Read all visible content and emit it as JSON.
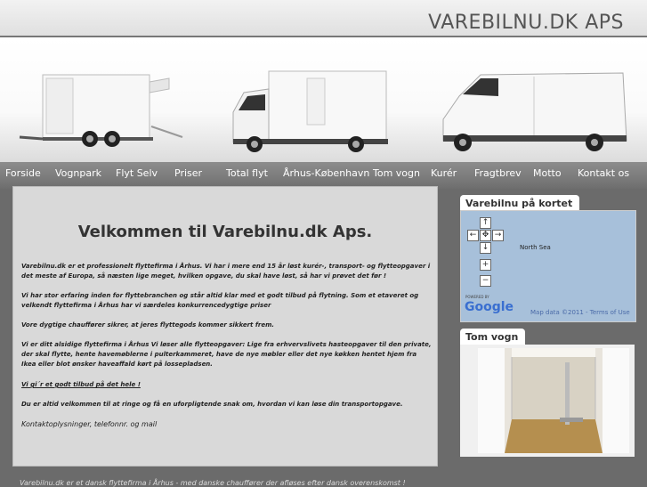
{
  "site": {
    "title": "VAREBILNU.DK APS"
  },
  "nav": {
    "items": [
      {
        "label": "Forside",
        "key": "forside"
      },
      {
        "label": "Vognpark",
        "key": "vognpark"
      },
      {
        "label": "Flyt Selv",
        "key": "flyt-selv"
      },
      {
        "label": "Priser",
        "key": "priser"
      },
      {
        "label": "Total flyt",
        "key": "total-flyt"
      },
      {
        "label": "Århus-København",
        "key": "arhus-kobenhavn"
      },
      {
        "label": "Tom vogn",
        "key": "tom-vogn"
      },
      {
        "label": "Kurér",
        "key": "kurer"
      },
      {
        "label": "Fragtbrev",
        "key": "fragtbrev"
      },
      {
        "label": "Motto",
        "key": "motto"
      },
      {
        "label": "Kontakt os",
        "key": "kontakt-os"
      }
    ]
  },
  "main": {
    "heading": "Velkommen til Varebilnu.dk Aps.",
    "paragraphs": [
      "Varebilnu.dk er et professionelt flyttefirma i Århus. Vi har i mere end 15 år løst kurér-, transport- og flytteopgaver i det meste af Europa, så næsten lige meget, hvilken opgave, du skal have løst, så har vi prøvet det før !",
      "Vi har stor erfaring inden for flyttebranchen og står altid klar med et godt tilbud på flytning. Som et etaveret og velkendt flyttefirma i Århus har vi særdeles konkurrencedygtige priser",
      "Vore dygtige chauffører sikrer, at jeres flyttegods kommer sikkert frem.",
      "Vi er ditt alsidige flyttefirma i Århus Vi løser alle flytteopgaver: Lige fra erhvervslivets hasteopgaver til den private, der skal flytte, hente havemøblerne i pulterkammeret, have de nye møbler eller det nye køkken hentet hjem fra Ikea eller blot ønsker haveaffald kørt på lossepladsen.",
      "Vi gi´r et godt tilbud på det hele !",
      "Du er altid velkommen til at ringe og få en uforpligtende snak om, hvordan vi kan løse din transportopgave.",
      "Kontaktoplysninger, telefonnr. og mail"
    ]
  },
  "sidebar": {
    "map_title": "Varebilnu på kortet",
    "map_label": "North Sea",
    "map_powered": "POWERED BY",
    "map_logo": "Google",
    "map_data": "Map data ©2011 - Terms of Use",
    "photo_title": "Tom vogn"
  },
  "footer": {
    "text": "Varebilnu.dk er et dansk flyttefirma i Århus - med danske chauffører der afløses efter dansk overenskomst !"
  },
  "colors": {
    "nav_bg": "#7a7a7a",
    "page_bg": "#6b6b6b",
    "content_bg": "#d9d9d9",
    "map_water": "#a7c0da"
  }
}
